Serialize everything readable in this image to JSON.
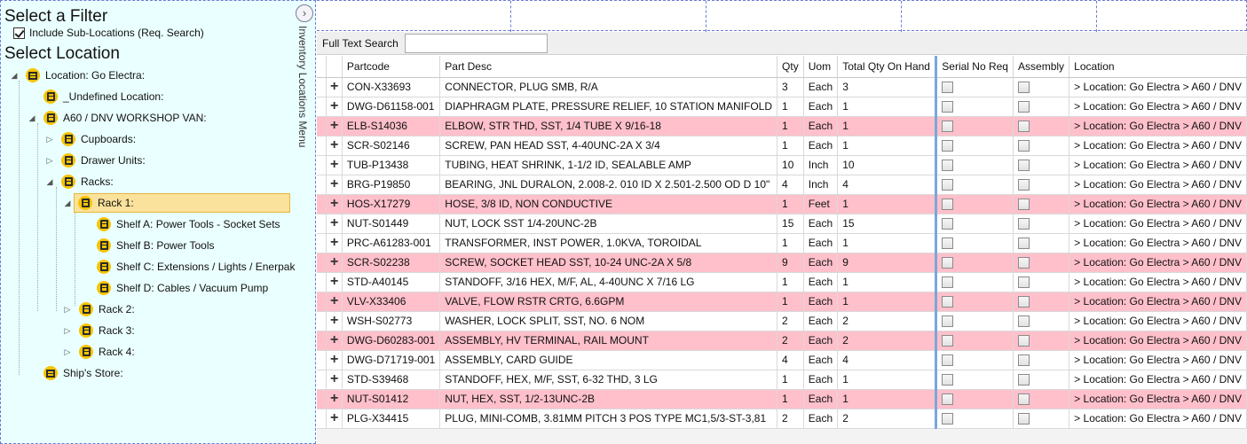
{
  "filter": {
    "heading": "Select a Filter",
    "include_sublocations_label": "Include Sub-Locations (Req. Search)",
    "include_sublocations_checked": true
  },
  "location": {
    "heading": "Select Location"
  },
  "side_menu": {
    "label": "Inventory Locations Menu"
  },
  "tree": {
    "root": "Location: Go Electra:",
    "undefined": "_Undefined Location:",
    "van": "A60 / DNV WORKSHOP VAN:",
    "cupboards": "Cupboards:",
    "drawer_units": "Drawer Units:",
    "racks": "Racks:",
    "rack1": "Rack 1:",
    "shelf_a": "Shelf A: Power Tools - Socket Sets",
    "shelf_b": "Shelf B: Power Tools",
    "shelf_c": "Shelf C: Extensions / Lights / Enerpak",
    "shelf_d": "Shelf D: Cables / Vacuum Pump",
    "rack2": "Rack 2:",
    "rack3": "Rack 3:",
    "rack4": "Rack 4:",
    "ships_store": "Ship's Store:"
  },
  "search": {
    "label": "Full Text Search",
    "value": ""
  },
  "grid": {
    "columns": {
      "partcode": "Partcode",
      "desc": "Part Desc",
      "qty": "Qty",
      "uom": "Uom",
      "total": "Total Qty On Hand",
      "serial": "Serial No Req",
      "assembly": "Assembly",
      "location": "Location"
    },
    "location_value": "> Location: Go Electra > A60 / DNV",
    "rows": [
      {
        "partcode": "CON-X33693",
        "desc": "CONNECTOR, PLUG SMB, R/A",
        "qty": "3",
        "uom": "Each",
        "total": "3",
        "hl": false
      },
      {
        "partcode": "DWG-D61158-001",
        "desc": "DIAPHRAGM PLATE, PRESSURE RELIEF, 10 STATION MANIFOLD",
        "qty": "1",
        "uom": "Each",
        "total": "1",
        "hl": false
      },
      {
        "partcode": "ELB-S14036",
        "desc": "ELBOW, STR THD, SST, 1/4 TUBE X 9/16-18",
        "qty": "1",
        "uom": "Each",
        "total": "1",
        "hl": true
      },
      {
        "partcode": "SCR-S02146",
        "desc": "SCREW, PAN HEAD SST, 4-40UNC-2A X 3/4",
        "qty": "1",
        "uom": "Each",
        "total": "1",
        "hl": false
      },
      {
        "partcode": "TUB-P13438",
        "desc": "TUBING, HEAT SHRINK, 1-1/2 ID, SEALABLE AMP",
        "qty": "10",
        "uom": "Inch",
        "total": "10",
        "hl": false
      },
      {
        "partcode": "BRG-P19850",
        "desc": "BEARING, JNL DURALON, 2.008-2. 010 ID X 2.501-2.500 OD D 10\"",
        "qty": "4",
        "uom": "Inch",
        "total": "4",
        "hl": false
      },
      {
        "partcode": "HOS-X17279",
        "desc": "HOSE, 3/8 ID, NON CONDUCTIVE",
        "qty": "1",
        "uom": "Feet",
        "total": "1",
        "hl": true
      },
      {
        "partcode": "NUT-S01449",
        "desc": "NUT, LOCK SST 1/4-20UNC-2B",
        "qty": "15",
        "uom": "Each",
        "total": "15",
        "hl": false
      },
      {
        "partcode": "PRC-A61283-001",
        "desc": "TRANSFORMER, INST POWER, 1.0KVA, TOROIDAL",
        "qty": "1",
        "uom": "Each",
        "total": "1",
        "hl": false
      },
      {
        "partcode": "SCR-S02238",
        "desc": "SCREW, SOCKET HEAD SST, 10-24 UNC-2A X 5/8",
        "qty": "9",
        "uom": "Each",
        "total": "9",
        "hl": true
      },
      {
        "partcode": "STD-A40145",
        "desc": "STANDOFF, 3/16 HEX, M/F, AL, 4-40UNC X 7/16 LG",
        "qty": "1",
        "uom": "Each",
        "total": "1",
        "hl": false
      },
      {
        "partcode": "VLV-X33406",
        "desc": "VALVE, FLOW RSTR CRTG, 6.6GPM",
        "qty": "1",
        "uom": "Each",
        "total": "1",
        "hl": true
      },
      {
        "partcode": "WSH-S02773",
        "desc": "WASHER, LOCK SPLIT, SST, NO. 6 NOM",
        "qty": "2",
        "uom": "Each",
        "total": "2",
        "hl": false
      },
      {
        "partcode": "DWG-D60283-001",
        "desc": "ASSEMBLY, HV TERMINAL, RAIL MOUNT",
        "qty": "2",
        "uom": "Each",
        "total": "2",
        "hl": true
      },
      {
        "partcode": "DWG-D71719-001",
        "desc": "ASSEMBLY, CARD GUIDE",
        "qty": "4",
        "uom": "Each",
        "total": "4",
        "hl": false
      },
      {
        "partcode": "STD-S39468",
        "desc": "STANDOFF, HEX, M/F, SST, 6-32 THD, 3 LG",
        "qty": "1",
        "uom": "Each",
        "total": "1",
        "hl": false
      },
      {
        "partcode": "NUT-S01412",
        "desc": "NUT, HEX, SST, 1/2-13UNC-2B",
        "qty": "1",
        "uom": "Each",
        "total": "1",
        "hl": true
      },
      {
        "partcode": "PLG-X34415",
        "desc": "PLUG, MINI-COMB, 3.81MM PITCH 3 POS TYPE MC1,5/3-ST-3,81",
        "qty": "2",
        "uom": "Each",
        "total": "2",
        "hl": false
      }
    ]
  },
  "colors": {
    "highlight_row": "#ffc0cb",
    "panel_bg": "#eaffff",
    "selected_node": "#fbe29c",
    "folder_icon": "#f6c400",
    "column_separator": "#7aa7dc"
  }
}
